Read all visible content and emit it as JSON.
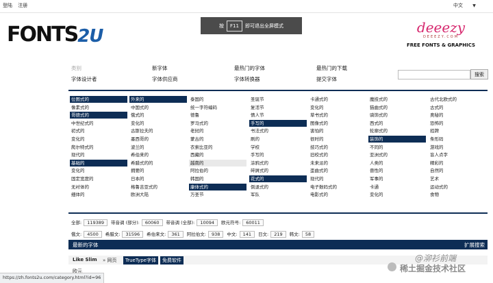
{
  "topbar": {
    "login": "登陆",
    "register": "注册",
    "language": "中文"
  },
  "logo": {
    "part1": "FONTS",
    "part2": "2U"
  },
  "fullscreen": {
    "prefix": "按",
    "key": "F11",
    "suffix": "即可退出全屏模式"
  },
  "ad": {
    "brand": "deeezy",
    "domain": "DEEEZY.COM",
    "tagline": "FREE FONTS & GRAPHICS"
  },
  "nav": {
    "row1": [
      "类别",
      "新字体",
      "最热门的字体",
      "最热门的下载"
    ],
    "row2": [
      "字体设计者",
      "字体供应商",
      "字体转换器",
      "提交字体"
    ]
  },
  "search": {
    "button": "搜索",
    "placeholder": ""
  },
  "categories": [
    [
      "位图式的",
      "像素式的",
      "哥德式的",
      "中世纪式的",
      "初式的",
      "变化的",
      "爬尔特式的",
      "现代的",
      "基础的",
      "变化的",
      "固定宽度的",
      "无衬体的",
      "细体的"
    ],
    [
      "外来的",
      "中国式的",
      "俄式的",
      "变化的",
      "古斯拉夫的",
      "墨西哥的",
      "波兰的",
      "希伯来的",
      "希腊式的的",
      "拥要的",
      "日本的",
      "格鲁吉亚式的",
      "欧洲大陆"
    ],
    [
      "泰国的",
      "统一字符编码",
      "德鲁",
      "罗马式的",
      "老挝的",
      "蒙古的",
      "衣索比亚的",
      "西藏的",
      "越南的",
      "阿拉伯的",
      "韩国的",
      "康体式的",
      "万圣节"
    ],
    [
      "圣诞节",
      "复活节",
      "情人节",
      "手写的",
      "书法式的",
      "刷的",
      "学校",
      "手写的",
      "涂鸦式的",
      "碎屑式的",
      "花式的",
      "倒退式的",
      "军队"
    ],
    [
      "卡通式的",
      "变化的",
      "草书式的",
      "图像式的",
      "害怕的",
      "很时的",
      "技巧式的",
      "旧校式的",
      "未来派的",
      "歪曲式的",
      "现代的",
      "电子数码式的",
      "电影式的"
    ],
    [
      "魔技式的",
      "猫曲式的",
      "骑饰式的",
      "西式的",
      "轮廓式的",
      "装饰的",
      "不同的",
      "亚洲式的",
      "人类的",
      "兽性的",
      "军事的",
      "卡通",
      "变化的"
    ],
    [
      "古代北欧式的",
      "古式的",
      "奥秘的",
      "恐怖的",
      "招牌",
      "条形码",
      "游戏的",
      "盲人点字",
      "精彩的",
      "自然的",
      "艺术",
      "运动式的",
      "食物"
    ]
  ],
  "highlighted": [
    "0.0",
    "0.2",
    "0.8",
    "1.0",
    "2.11",
    "3.3",
    "3.10",
    "5.5"
  ],
  "lightgray": [
    "2.8"
  ],
  "stats": {
    "row1": [
      {
        "label": "全部:",
        "value": "119389"
      },
      {
        "label": "带音调 (部分):",
        "value": "60060"
      },
      {
        "label": "带音调 (全部):",
        "value": "10094"
      },
      {
        "label": "欧元符号:",
        "value": "60011"
      }
    ],
    "row2": [
      {
        "label": "俄文:",
        "value": "4500"
      },
      {
        "label": "希腊文:",
        "value": "31596"
      },
      {
        "label": "希伯来文:",
        "value": "361"
      },
      {
        "label": "阿拉伯文:",
        "value": "938"
      },
      {
        "label": "中文:",
        "value": "141"
      },
      {
        "label": "日文:",
        "value": "219"
      },
      {
        "label": "韩文:",
        "value": "58"
      }
    ]
  },
  "latest": {
    "title": "最新的字体",
    "extend_search": "扩展搜索"
  },
  "font_entry": {
    "name": "Like Slim",
    "sep": "» 网页",
    "tag1": "TrueType字体",
    "tag2": "免费软件",
    "desc": "欧元"
  },
  "statusbar": {
    "url": "https://zh.fonts2u.com/category.html?id=96"
  },
  "watermark": {
    "line1": "@泖衫前端",
    "line2": "稀土掘金技术社区"
  }
}
